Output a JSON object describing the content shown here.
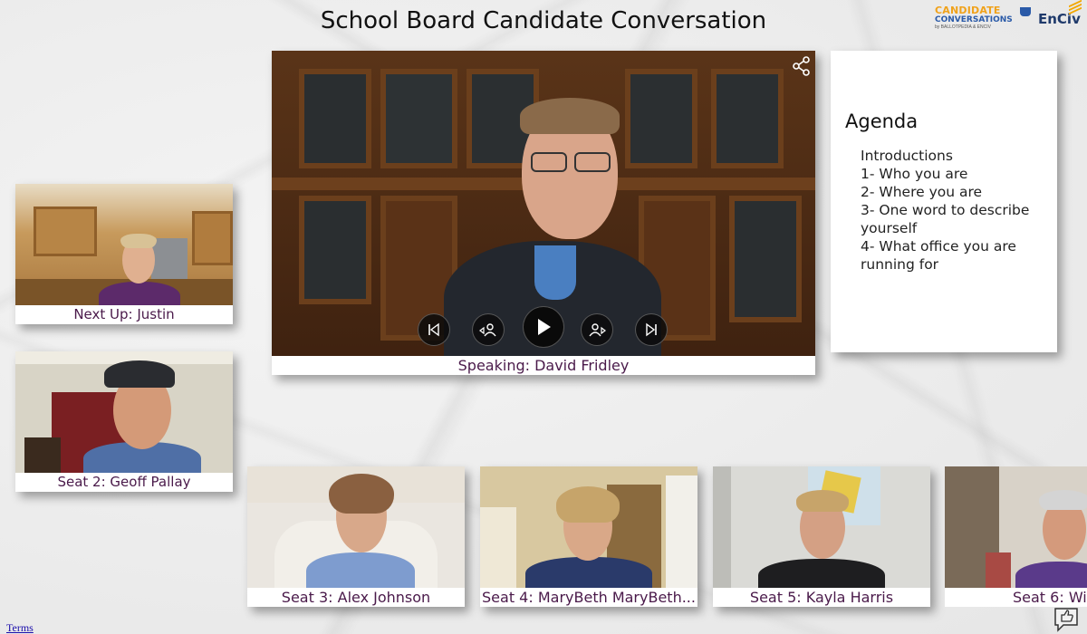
{
  "page": {
    "title": "School Board Candidate Conversation",
    "terms_link": "Terms"
  },
  "logos": {
    "candidate_conversations": {
      "line1": "CANDIDATE",
      "line2": "CONVERSATIONS",
      "sub": "by BALLOTPEDIA & ENCIV"
    },
    "enciv": "EnCiv"
  },
  "main_video": {
    "speaker_label": "Speaking: David Fridley",
    "controls": [
      "skip-back-icon",
      "previous-speaker-icon",
      "play-icon",
      "next-speaker-icon",
      "skip-forward-icon"
    ],
    "share_icon": "share-icon"
  },
  "agenda": {
    "heading": "Agenda",
    "items": [
      "Introductions",
      "1- Who you are",
      "2- Where you are",
      "3- One word to describe yourself",
      "4- What office you are running for"
    ]
  },
  "side_tiles": [
    {
      "label": "Next Up: Justin"
    },
    {
      "label": "Seat 2: Geoff Pallay"
    }
  ],
  "seat_tiles": [
    {
      "label": "Seat 3: Alex Johnson"
    },
    {
      "label": "Seat 4: MaryBeth MaryBeth..."
    },
    {
      "label": "Seat 5: Kayla Harris"
    },
    {
      "label": "Seat 6: Wi"
    }
  ],
  "colors": {
    "label_text": "#4a1a4a",
    "accent_orange": "#f0a21b",
    "accent_blue": "#2a5aa8"
  }
}
